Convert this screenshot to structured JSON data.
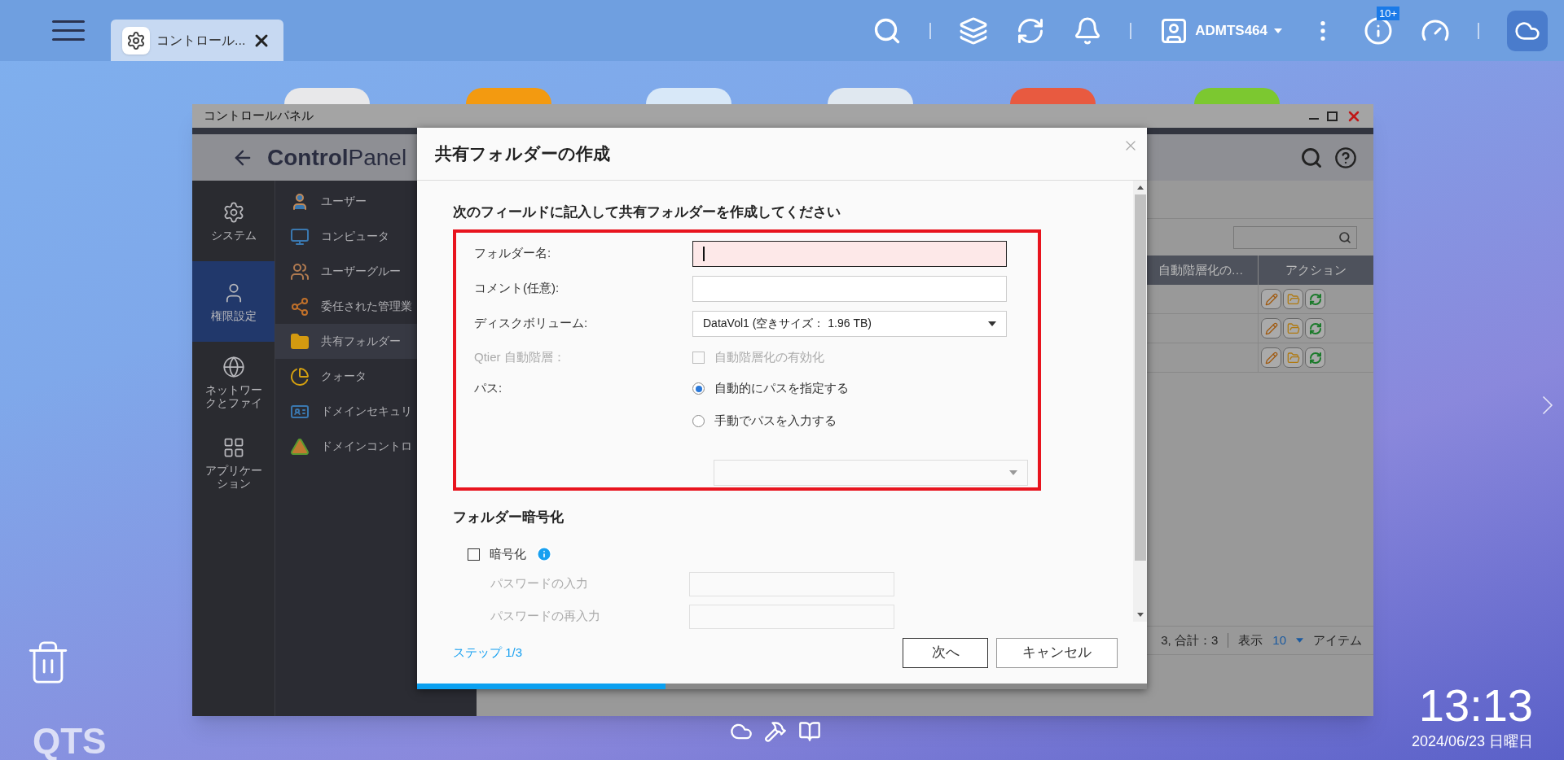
{
  "topbar": {
    "tab": {
      "label": "コントロール..."
    },
    "user": "ADMTS464",
    "badge": "10+"
  },
  "window": {
    "title": "コントロールパネル",
    "header": "**Control**Panel",
    "nav": [
      {
        "kind": "gear",
        "label": "システム",
        "selected": false
      },
      {
        "kind": "user",
        "label": "権限設定",
        "selected": true
      },
      {
        "kind": "globe",
        "label": "ネットワークとファイ",
        "selected": false
      },
      {
        "kind": "apps",
        "label": "アプリケーション",
        "selected": false
      }
    ],
    "sub_nav": [
      {
        "kind": "user",
        "label": "ユーザー",
        "selected": false
      },
      {
        "kind": "computer",
        "label": "コンピュータ",
        "selected": false
      },
      {
        "kind": "group",
        "label": "ユーザーグルー",
        "selected": false
      },
      {
        "kind": "delegate",
        "label": "委任された管理業",
        "selected": false
      },
      {
        "kind": "folder",
        "label": "共有フォルダー",
        "selected": true
      },
      {
        "kind": "quota",
        "label": "クォータ",
        "selected": false
      },
      {
        "kind": "security",
        "label": "ドメインセキュリ",
        "selected": false
      },
      {
        "kind": "controller",
        "label": "ドメインコントロ",
        "selected": false
      }
    ],
    "table": {
      "columns": [
        "自動階層化の…",
        "アクション"
      ],
      "rows": [
        {
          "kind": "actions"
        },
        {
          "kind": "actions"
        },
        {
          "kind": "actions"
        }
      ],
      "pager": {
        "summary": "3, 合計：3",
        "show": "表示",
        "per_page": "10",
        "unit": "アイテム"
      }
    }
  },
  "dialog": {
    "title": "共有フォルダーの作成",
    "heading": "次のフィールドに記入して共有フォルダーを作成してください",
    "fields": [
      {
        "kind": "text",
        "label": "フォルダー名:",
        "focused": true
      },
      {
        "kind": "text",
        "label": "コメント(任意):",
        "focused": false
      },
      {
        "kind": "select",
        "label": "ディスクボリューム:",
        "value": "DataVol1 (空きサイズ： 1.96 TB)",
        "disabled": false
      },
      {
        "kind": "checkbox",
        "label": "Qtier 自動階層：",
        "option": "自動階層化の有効化",
        "checked": false,
        "disabled": true
      },
      {
        "kind": "radio",
        "label": "パス:",
        "options": [
          {
            "label": "自動的にパスを指定する",
            "selected": true
          },
          {
            "label": "手動でパスを入力する",
            "selected": false
          }
        ]
      },
      {
        "kind": "select",
        "disabled": true
      }
    ],
    "encryption": {
      "heading": "フォルダー暗号化",
      "checkbox": {
        "label": "暗号化",
        "checked": false
      },
      "fields": [
        {
          "label": "パスワードの入力",
          "disabled": true
        },
        {
          "label": "パスワードの再入力",
          "disabled": true
        }
      ]
    },
    "step": "ステップ 1/3",
    "buttons": [
      "次へ",
      "キャンセル"
    ],
    "progress": {
      "level": 0.34
    }
  },
  "desktop": {
    "logo": "QTS",
    "clock": "13:13",
    "date": "2024/06/23 日曜日"
  }
}
